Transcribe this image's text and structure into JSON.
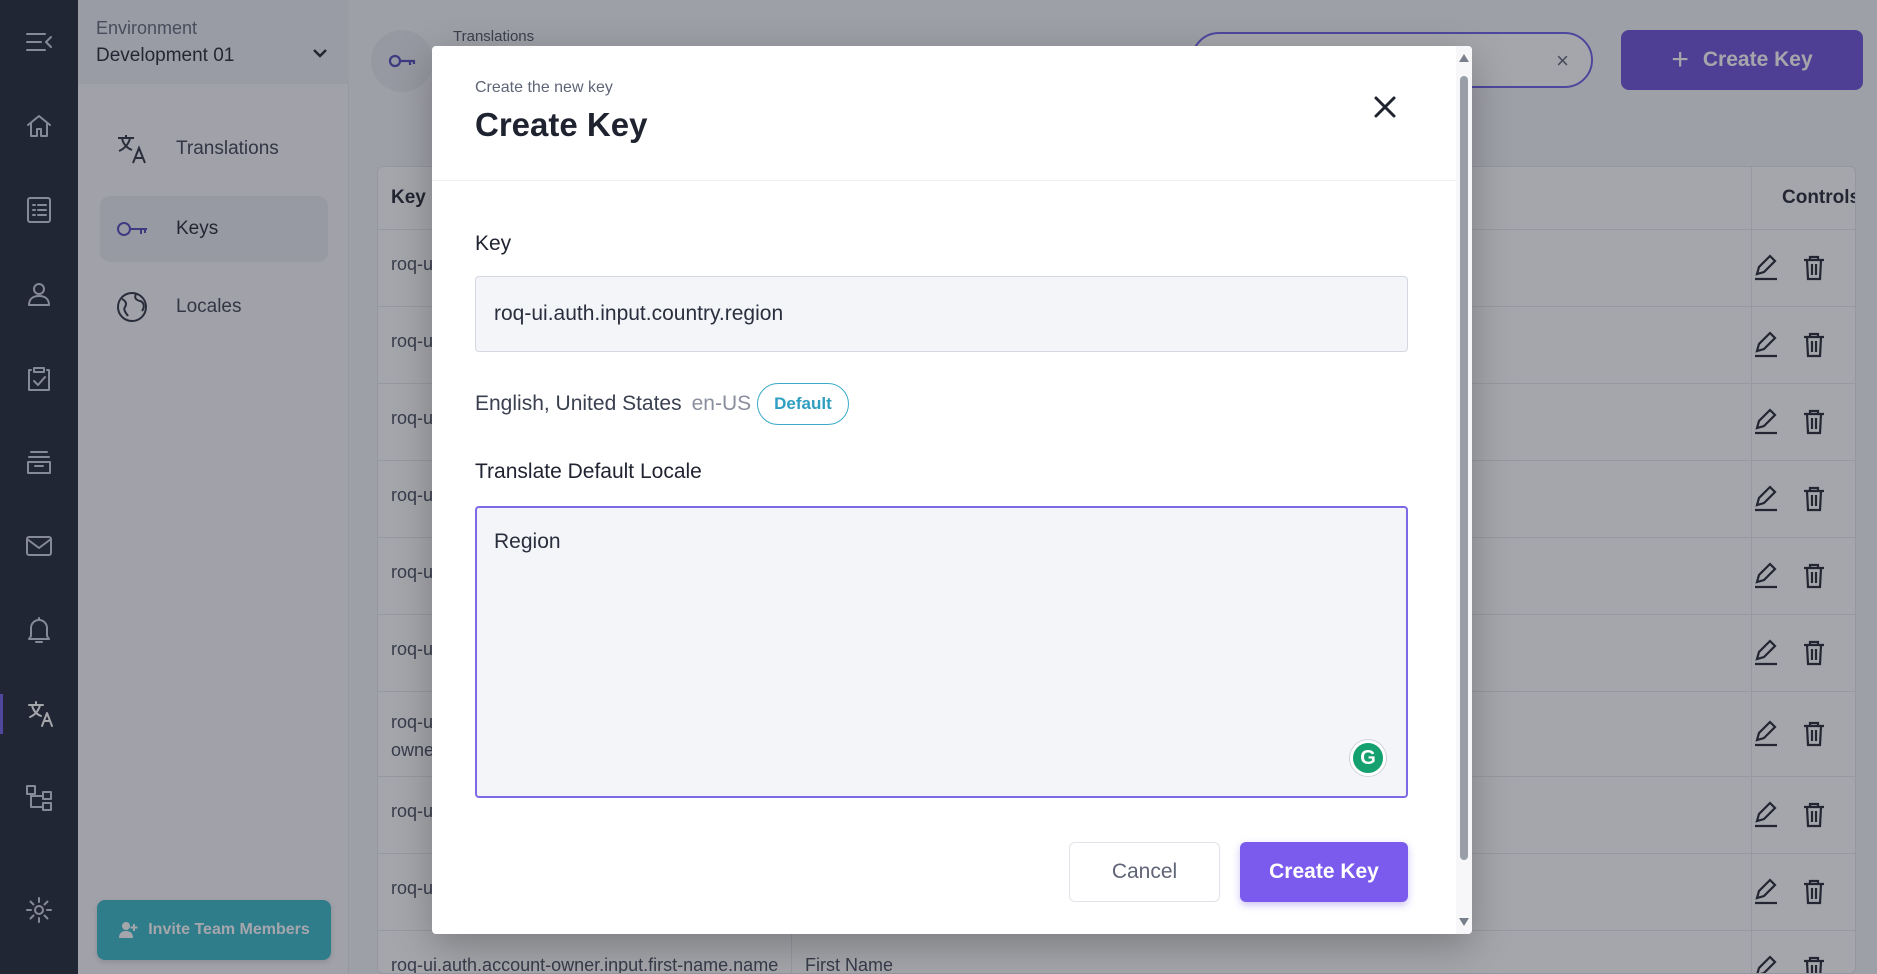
{
  "sidebar": {
    "environment_label": "Environment",
    "environment_value": "Development 01",
    "nav": [
      {
        "label": "Translations",
        "icon": "translate-icon"
      },
      {
        "label": "Keys",
        "icon": "key-icon",
        "active": true
      },
      {
        "label": "Locales",
        "icon": "globe-icon"
      }
    ],
    "invite_label": "Invite Team Members"
  },
  "rail": {
    "icons": [
      "menu-collapse-icon",
      "home-icon",
      "list-icon",
      "user-icon",
      "clipboard-check-icon",
      "archive-icon",
      "mail-icon",
      "bell-icon",
      "translate-icon",
      "hierarchy-icon",
      "gear-icon"
    ],
    "active": "translate-icon"
  },
  "header": {
    "breadcrumb": "Translations",
    "create_button_label": "Create Key",
    "search_clear": "×"
  },
  "table": {
    "columns": [
      "Key",
      "Controls"
    ],
    "rows": [
      {
        "key": "roq-u",
        "value": ""
      },
      {
        "key": "roq-u",
        "value": ""
      },
      {
        "key": "roq-u",
        "value": ""
      },
      {
        "key": "roq-u",
        "value": ""
      },
      {
        "key": "roq-u",
        "value": ""
      },
      {
        "key": "roq-u",
        "value": ""
      },
      {
        "key": "roq-u owne",
        "value": ""
      },
      {
        "key": "roq-u",
        "value": ""
      },
      {
        "key": "roq-u",
        "value": ""
      },
      {
        "key": "roq-ui.auth.account-owner.input.first-name.name",
        "value": "First Name"
      }
    ]
  },
  "modal": {
    "subtitle": "Create the new key",
    "title": "Create Key",
    "key_label": "Key",
    "key_value": "roq-ui.auth.input.country.region",
    "locale_name": "English, United States",
    "locale_code": "en-US",
    "locale_badge": "Default",
    "translate_label": "Translate Default Locale",
    "translate_value": "Region",
    "cancel_label": "Cancel",
    "create_label": "Create Key"
  },
  "colors": {
    "accent": "#7b5bee",
    "rail_bg": "#1c2333",
    "badge": "#2f9ec0",
    "invite": "#35b8c9"
  }
}
